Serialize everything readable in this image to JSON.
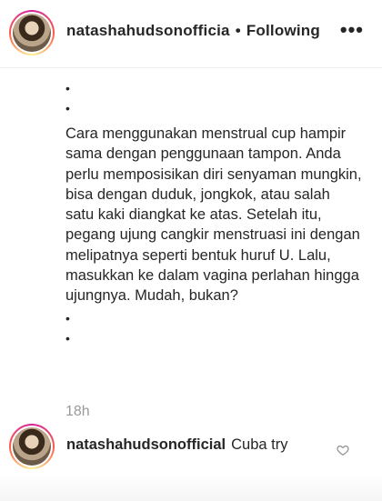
{
  "post": {
    "username": "natashahudsonofficia",
    "separator": "•",
    "follow_status": "Following",
    "more_label": "•••"
  },
  "caption": {
    "bullet": "•",
    "text": "Cara menggunakan menstrual cup hampir sama dengan penggunaan tampon. Anda perlu memposisikan diri senyaman mungkin, bisa dengan duduk, jongkok, atau salah satu kaki diangkat ke atas. Setelah itu, pegang ujung cangkir menstruasi ini dengan melipatnya seperti bentuk huruf U. Lalu, masukkan ke dalam vagina perlahan hingga ujungnya. Mudah, bukan?",
    "time": "18h"
  },
  "comment": {
    "username": "natashahudsonofficial",
    "text": "Cuba try"
  },
  "colors": {
    "story_ring": "#d6249f",
    "secondary_text": "#999999"
  }
}
